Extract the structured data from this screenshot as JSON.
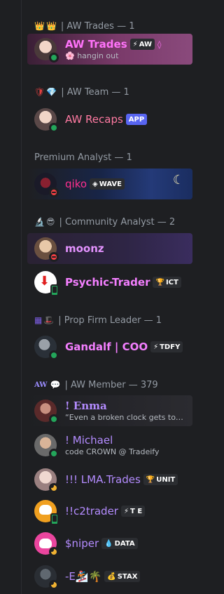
{
  "sections": [
    {
      "title": "| AW Trades — 1",
      "icons": [
        "👑",
        "👑"
      ]
    },
    {
      "title": "| AW Team — 1",
      "icons": [
        "🛡",
        "💎"
      ]
    },
    {
      "title": "Premium Analyst — 1",
      "icons": []
    },
    {
      "title": "| Community Analyst — 2",
      "icons": [
        "🔬",
        "😎"
      ]
    },
    {
      "title": "| Prop Firm Leader — 1",
      "icons": [
        "▦",
        "🎩"
      ]
    },
    {
      "title": "| AW Member — 379",
      "icons": [
        "AW",
        "💬"
      ]
    }
  ],
  "members": [
    {
      "name": "AW Trades",
      "name_color": "#ff73fa",
      "tag": "AW",
      "tag_icon": "⚡",
      "sub": "hangin out",
      "sub_icon": "🌸",
      "status": "online",
      "boost": "◊"
    },
    {
      "name": "AW Recaps",
      "name_color": "#ff7aa2",
      "tag": "APP",
      "tag_icon": "",
      "sub": "",
      "status": "online"
    },
    {
      "name": "qiko",
      "name_color": "#ff2f8e",
      "tag": "WAVE",
      "tag_icon": "◈",
      "sub": "",
      "status": "dnd"
    },
    {
      "name": "moonz",
      "name_color": "#e493ff",
      "tag": "",
      "tag_icon": "",
      "sub": "",
      "status": "dnd"
    },
    {
      "name": "Psychic-Trader",
      "name_color": "#f47fff",
      "tag": "ICT",
      "tag_icon": "🏆",
      "sub": "",
      "status": "mobile"
    },
    {
      "name": "Gandalf | COO",
      "name_color": "#f47fff",
      "tag": "TDFY",
      "tag_icon": "⚡",
      "sub": "",
      "status": "online"
    },
    {
      "name": "! Enma",
      "name_color": "#b48cff",
      "tag": "",
      "tag_icon": "",
      "sub": "“Even a broken clock gets to b...",
      "status": "online"
    },
    {
      "name": "! Michael",
      "name_color": "#b48cff",
      "tag": "",
      "tag_icon": "",
      "sub": "code CROWN @ Tradeify",
      "status": "online"
    },
    {
      "name": "!!! LMA.Trades",
      "name_color": "#b48cff",
      "tag": "UNIT",
      "tag_icon": "🏆",
      "sub": "",
      "status": "idle"
    },
    {
      "name": "!!c2trader",
      "name_color": "#b48cff",
      "tag": "T E",
      "tag_icon": "⚡",
      "sub": "",
      "status": "mobile"
    },
    {
      "name": "$niper",
      "name_color": "#b48cff",
      "tag": "DATA",
      "tag_icon": "💧",
      "sub": "",
      "status": "idle"
    },
    {
      "name": "-E🏂🌴",
      "name_color": "#b48cff",
      "tag": "STAX",
      "tag_icon": "💰",
      "sub": "",
      "status": "idle"
    }
  ]
}
